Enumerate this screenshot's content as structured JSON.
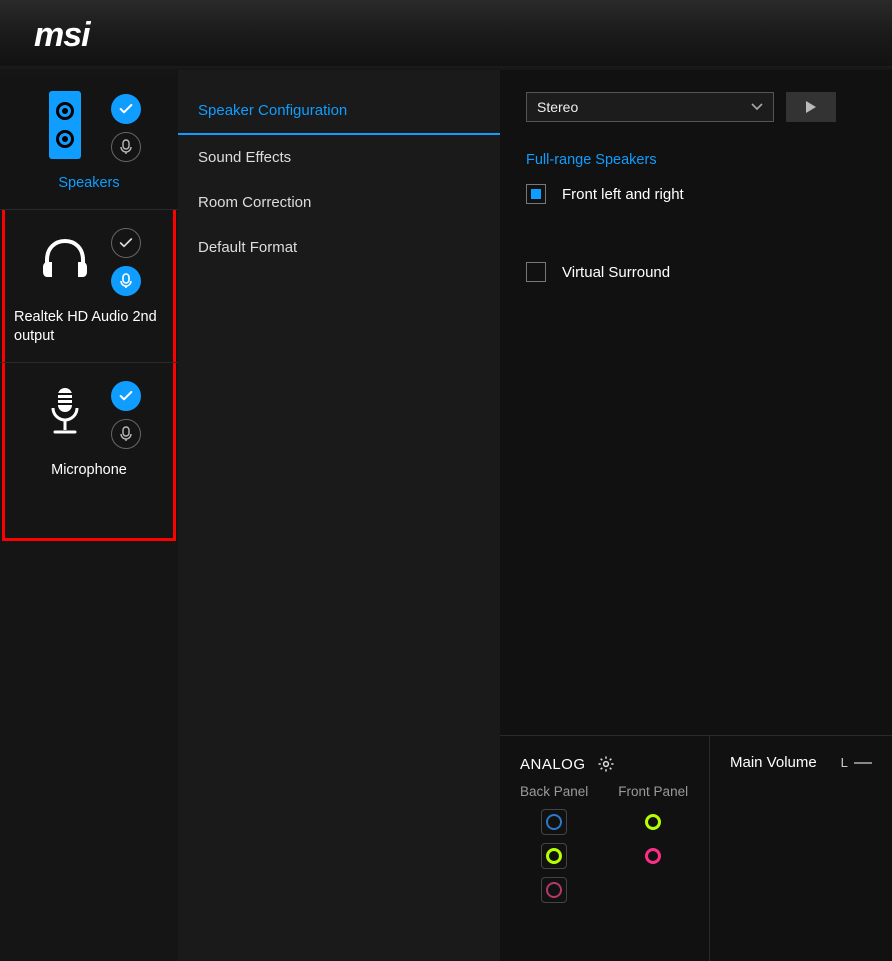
{
  "brand": "msi",
  "sidebar": {
    "devices": [
      {
        "label": "Speakers",
        "check_active": true,
        "mic_active": false,
        "active": true
      },
      {
        "label": "Realtek HD Audio 2nd output",
        "check_active": false,
        "mic_active": true,
        "active": false
      },
      {
        "label": "Microphone",
        "check_active": true,
        "mic_active": false,
        "active": false
      }
    ]
  },
  "tabs": [
    {
      "label": "Speaker Configuration",
      "active": true
    },
    {
      "label": "Sound Effects",
      "active": false
    },
    {
      "label": "Room Correction",
      "active": false
    },
    {
      "label": "Default Format",
      "active": false
    }
  ],
  "config": {
    "selected_mode": "Stereo",
    "section_title": "Full-range Speakers",
    "front_lr": {
      "label": "Front left and right",
      "checked": true
    },
    "virtual": {
      "label": "Virtual Surround",
      "checked": false
    }
  },
  "analog": {
    "title": "ANALOG",
    "back_label": "Back Panel",
    "front_label": "Front Panel",
    "back_jacks": [
      "#2d79c7",
      "#b6ff00",
      "#b23a6b"
    ],
    "front_jacks": [
      "#b6ff00",
      "#ff2d86"
    ]
  },
  "volume": {
    "title": "Main Volume",
    "channel": "L"
  }
}
